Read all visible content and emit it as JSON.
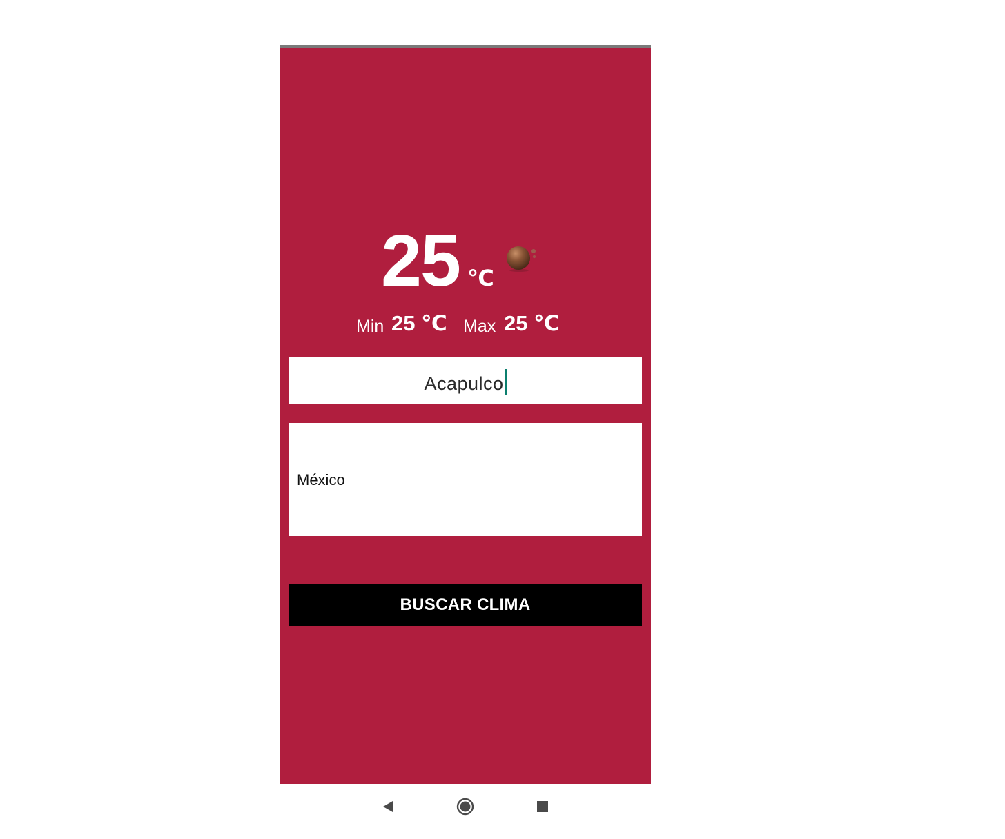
{
  "weather": {
    "temperature": "25",
    "unit": "℃",
    "icon": "weather-icon"
  },
  "minmax": {
    "min_label": "Min",
    "min_value": "25 ℃",
    "max_label": "Max",
    "max_value": "25 ℃"
  },
  "city_input": {
    "value": "Acapulco"
  },
  "country_field": {
    "value": "México"
  },
  "search_button": {
    "label": "BUSCAR CLIMA"
  },
  "navigation": {
    "back": "back-icon",
    "home": "home-icon",
    "recents": "recents-icon"
  },
  "colors": {
    "background": "#b01e3e",
    "button": "#000000",
    "cursor": "#0b7f6e"
  }
}
